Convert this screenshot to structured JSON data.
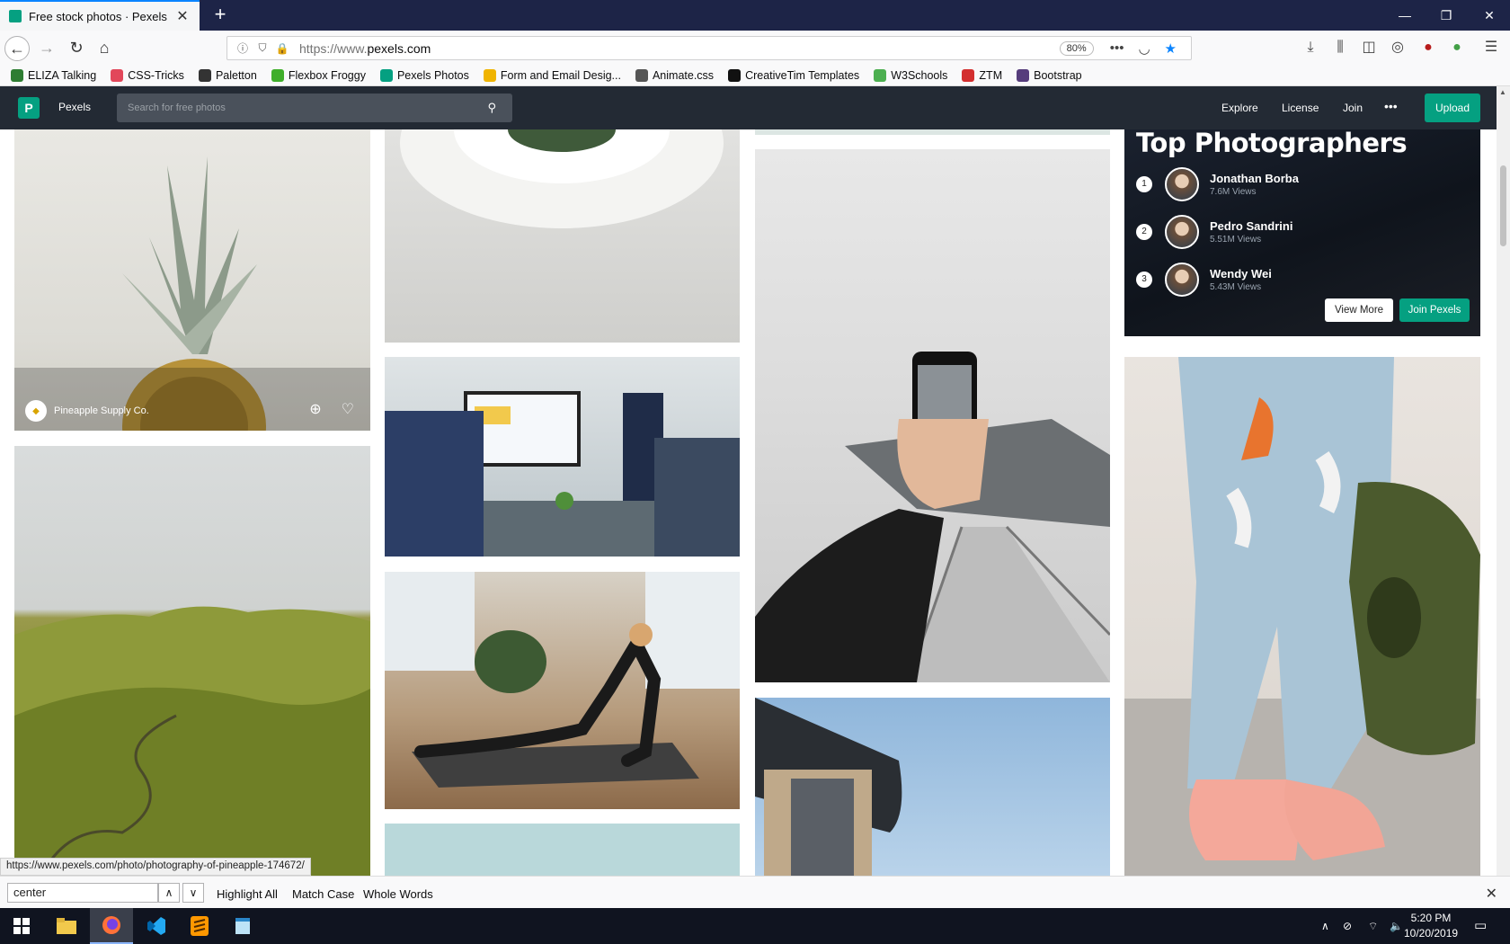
{
  "browser": {
    "tab_title": "Free stock photos · Pexels",
    "url_scheme": "https://www.",
    "url_host": "pexels.com",
    "zoom": "80%",
    "bookmarks": [
      {
        "label": "ELIZA Talking",
        "color": "#2e7d32"
      },
      {
        "label": "CSS-Tricks",
        "color": "#e2475a"
      },
      {
        "label": "Paletton",
        "color": "#333333"
      },
      {
        "label": "Flexbox Froggy",
        "color": "#3fae2a"
      },
      {
        "label": "Pexels Photos",
        "color": "#05a081"
      },
      {
        "label": "Form and Email Desig...",
        "color": "#f0b400"
      },
      {
        "label": "Animate.css",
        "color": "#555555"
      },
      {
        "label": "CreativeTim Templates",
        "color": "#111111"
      },
      {
        "label": "W3Schools",
        "color": "#4caf50"
      },
      {
        "label": "ZTM",
        "color": "#d32f2f"
      },
      {
        "label": "Bootstrap",
        "color": "#563d7c"
      }
    ]
  },
  "pexels": {
    "brand": "Pexels",
    "search_placeholder": "Search for free photos",
    "nav": [
      "Explore",
      "License",
      "Join"
    ],
    "more": "•••",
    "upload": "Upload",
    "photo_credit": "Pineapple Supply Co.",
    "top_photographers": {
      "title": "Top Photographers",
      "list": [
        {
          "rank": "1",
          "name": "Jonathan Borba",
          "views": "7.6M Views"
        },
        {
          "rank": "2",
          "name": "Pedro Sandrini",
          "views": "5.51M Views"
        },
        {
          "rank": "3",
          "name": "Wendy Wei",
          "views": "5.43M Views"
        }
      ],
      "view_more": "View More",
      "join": "Join Pexels"
    }
  },
  "status_link": "https://www.pexels.com/photo/photography-of-pineapple-174672/",
  "findbar": {
    "query": "center",
    "highlight_all": "Highlight All",
    "match_case": "Match Case",
    "whole_words": "Whole Words"
  },
  "taskbar": {
    "time": "5:20 PM",
    "date": "10/20/2019"
  }
}
